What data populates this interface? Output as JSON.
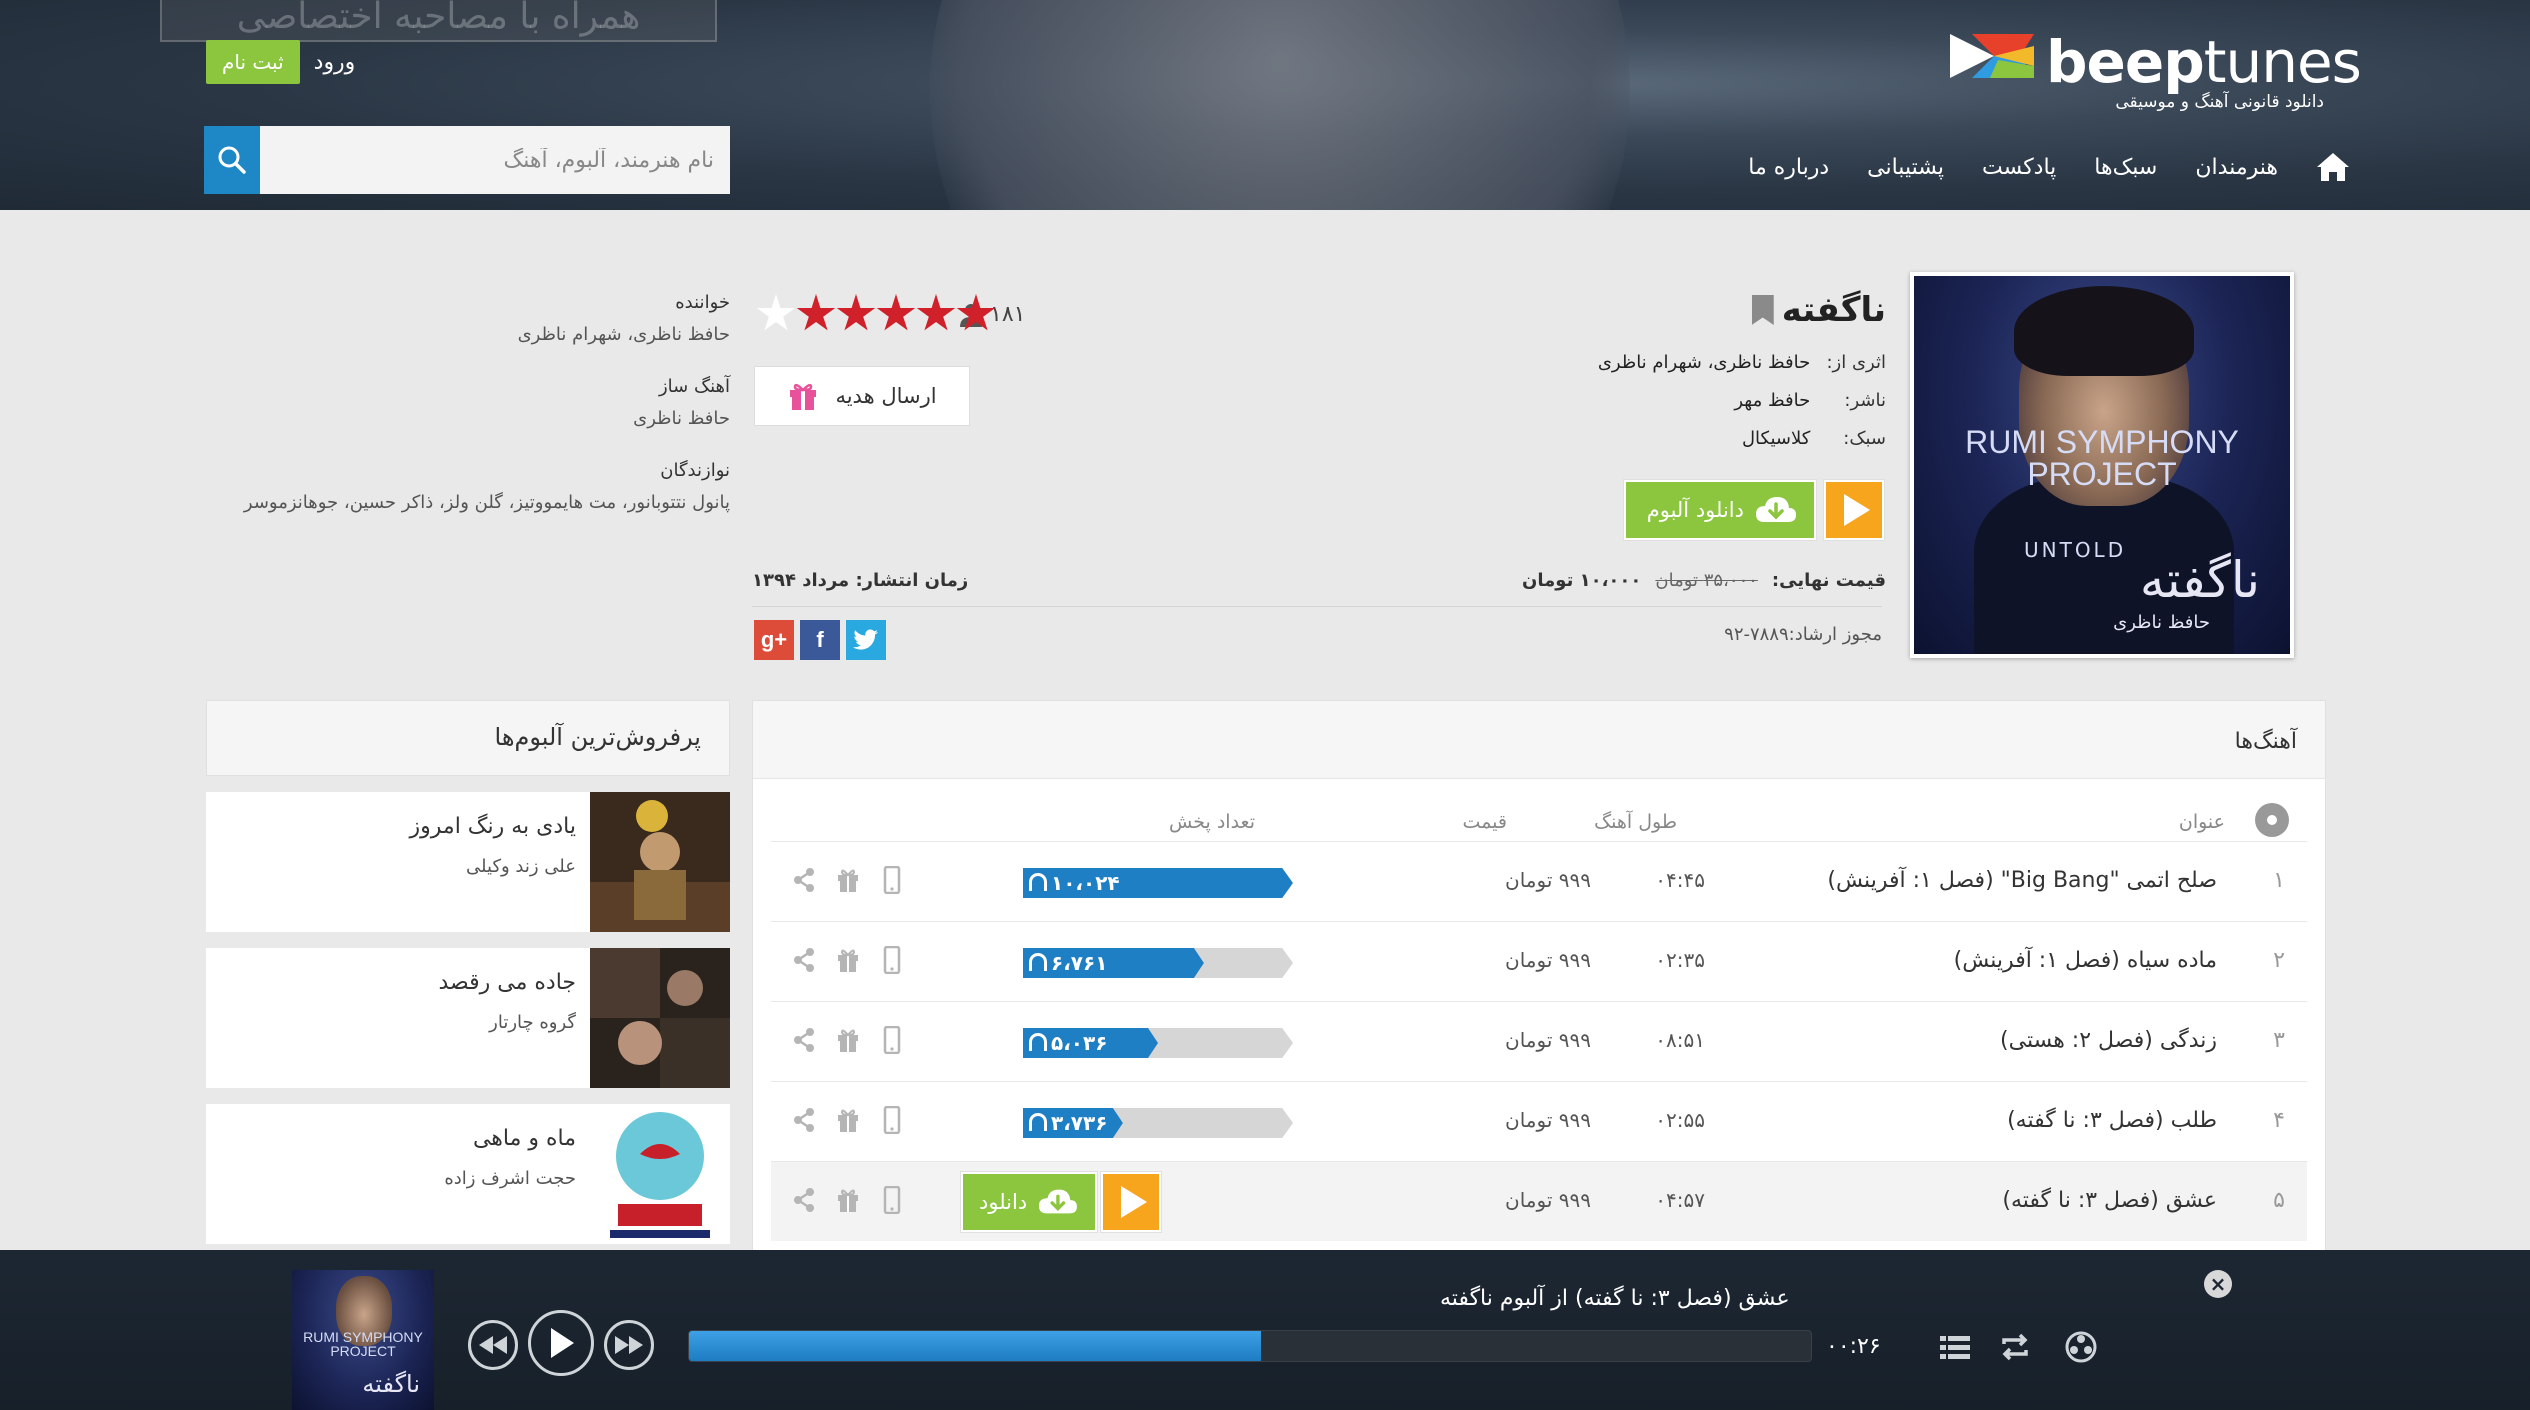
{
  "header": {
    "promo_text": "همراه با مصاحبه اختصاصی",
    "logo_brand_bold": "beep",
    "logo_brand_light": "tunes",
    "logo_tagline": "دانلود قانونی آهنگ و موسیقی",
    "register_label": "ثبت نام",
    "login_label": "ورود",
    "search_placeholder": "نام هنرمند، آلبوم، آهنگ",
    "nav": [
      "هنرمندان",
      "سبک‌ها",
      "پادکست",
      "پشتیبانی",
      "درباره ما"
    ]
  },
  "album": {
    "cover_title_en": "RUMI SYMPHONY PROJECT",
    "cover_untold": "UNTOLD",
    "cover_title_fa": "ناگفته",
    "cover_artist_fa": "حافظ ناظری",
    "title": "ناگفته",
    "by_label": "اثری از:",
    "by_value": "حافظ ناظری، شهرام ناظری",
    "publisher_label": "ناشر:",
    "publisher_value": "حافظ مهر",
    "genre_label": "سبک:",
    "genre_value": "کلاسیکال",
    "download_label": "دانلود آلبوم",
    "final_price_label": "قیمت نهایی:",
    "old_price": "۳۵،۰۰۰ تومان",
    "new_price": "۱۰،۰۰۰ تومان",
    "release_label": "زمان انتشار: مرداد ۱۳۹۴",
    "license": "مجوز ارشاد:۷۸۸۹-۹۲",
    "raters": "۱۸۱",
    "rating": 5,
    "rating_max": 6,
    "gift_label": "ارسال هدیه",
    "social": [
      "g+",
      "f",
      "t"
    ],
    "colors": {
      "star": "#d0202a",
      "green": "#8cc63f",
      "orange": "#f7a51c",
      "blue": "#1f7fc4"
    }
  },
  "credits": [
    {
      "role": "خواننده",
      "names": "حافظ ناظری، شهرام ناظری"
    },
    {
      "role": "آهنگ ساز",
      "names": "حافظ ناظری"
    },
    {
      "role": "نوازندگان",
      "names": "پانول نتتوبانور، مت هایمووتیز، گلن ولز، ذاکر حسین، جوهانزموسر"
    }
  ],
  "bestsellers": {
    "title": "پرفروش‌ترین آلبوم‌ها",
    "items": [
      {
        "name": "یادی به رنگ امروز",
        "artist": "علی زند وکیلی"
      },
      {
        "name": "جاده می رقصد",
        "artist": "گروه چارتار"
      },
      {
        "name": "ماه و ماهی",
        "artist": "حجت اشرف زاده"
      }
    ]
  },
  "tracks": {
    "title": "آهنگ‌ها",
    "columns": {
      "title": "عنوان",
      "length": "طول آهنگ",
      "price": "قیمت",
      "plays": "تعداد پخش"
    },
    "download_label": "دانلود",
    "rows": [
      {
        "num": "۱",
        "name": "صلح اتمی \"Big Bang\" (فصل ۱: آفرینش)",
        "length": "۰۴:۴۵",
        "price": "۹۹۹ تومان",
        "plays": "۱۰،۰۲۴",
        "plays_fraction": 1.0
      },
      {
        "num": "۲",
        "name": "ماده سیاه (فصل ۱: آفرینش)",
        "length": "۰۲:۳۵",
        "price": "۹۹۹ تومان",
        "plays": "۶،۷۶۱",
        "plays_fraction": 0.67
      },
      {
        "num": "۳",
        "name": "زندگی (فصل ۲: هستی)",
        "length": "۰۸:۵۱",
        "price": "۹۹۹ تومان",
        "plays": "۵،۰۳۶",
        "plays_fraction": 0.5
      },
      {
        "num": "۴",
        "name": "طلب (فصل ۳: نا گفته)",
        "length": "۰۲:۵۵",
        "price": "۹۹۹ تومان",
        "plays": "۳،۷۳۶",
        "plays_fraction": 0.37
      },
      {
        "num": "۵",
        "name": "عشق (فصل ۳: نا گفته)",
        "length": "۰۴:۵۷",
        "price": "۹۹۹ تومان",
        "plays": "",
        "plays_fraction": 0
      }
    ]
  },
  "player": {
    "now_playing": "عشق (فصل ۳: نا گفته) از آلبوم ناگفته",
    "time": "۰۰:۲۶",
    "progress": 0.51,
    "cover_text": "RUMI SYMPHONY PROJECT",
    "cover_fa": "ناگفته"
  }
}
